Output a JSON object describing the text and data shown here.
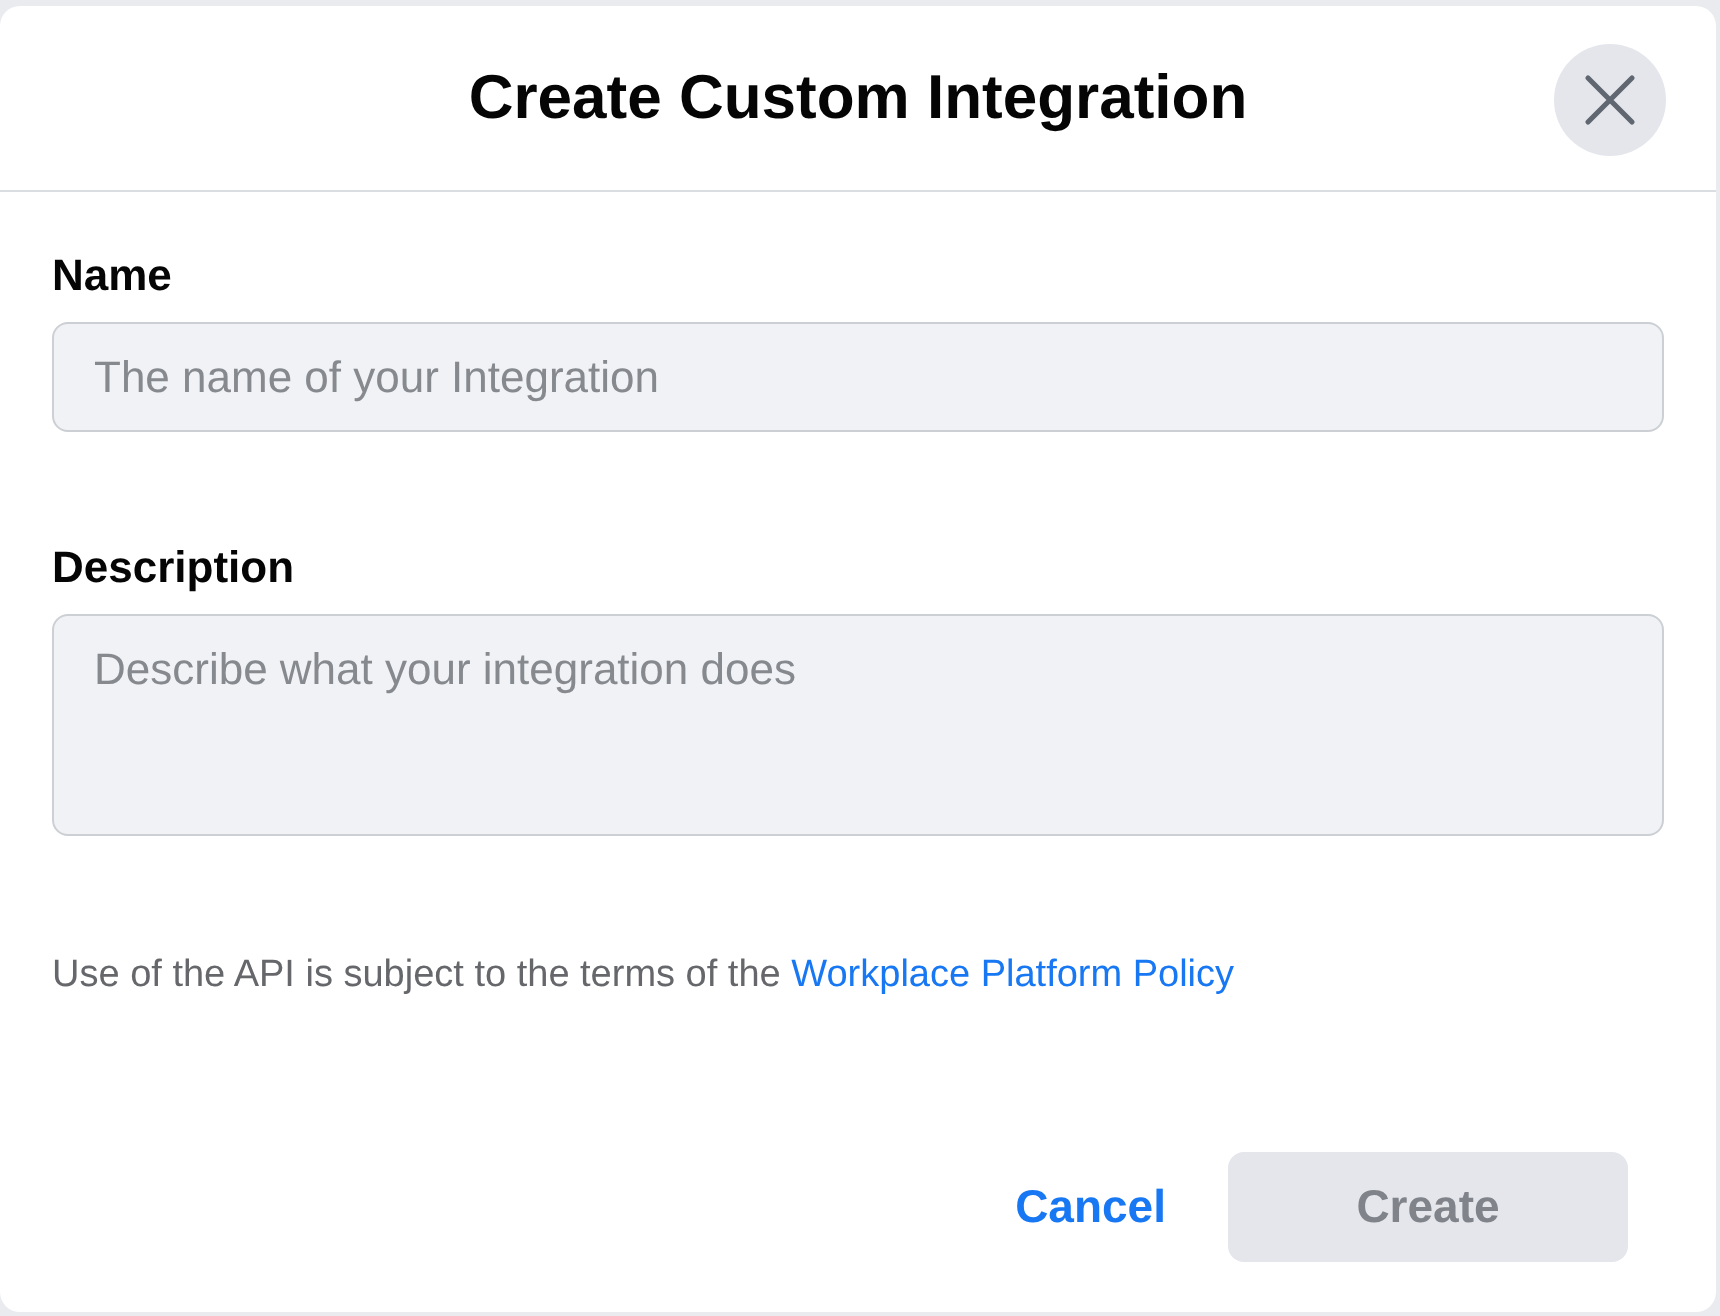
{
  "dialog": {
    "title": "Create Custom Integration"
  },
  "fields": [
    {
      "kind": "input",
      "label": "Name",
      "placeholder": "The name of your Integration"
    },
    {
      "kind": "textarea",
      "label": "Description",
      "placeholder": "Describe what your integration does"
    }
  ],
  "policy": {
    "text": "Use of the API is subject to the terms of the",
    "link": "Workplace Platform Policy"
  },
  "buttons": [
    {
      "kind": "link",
      "label": "Cancel",
      "disabled": false
    },
    {
      "kind": "primary",
      "label": "Create",
      "disabled": true
    }
  ]
}
